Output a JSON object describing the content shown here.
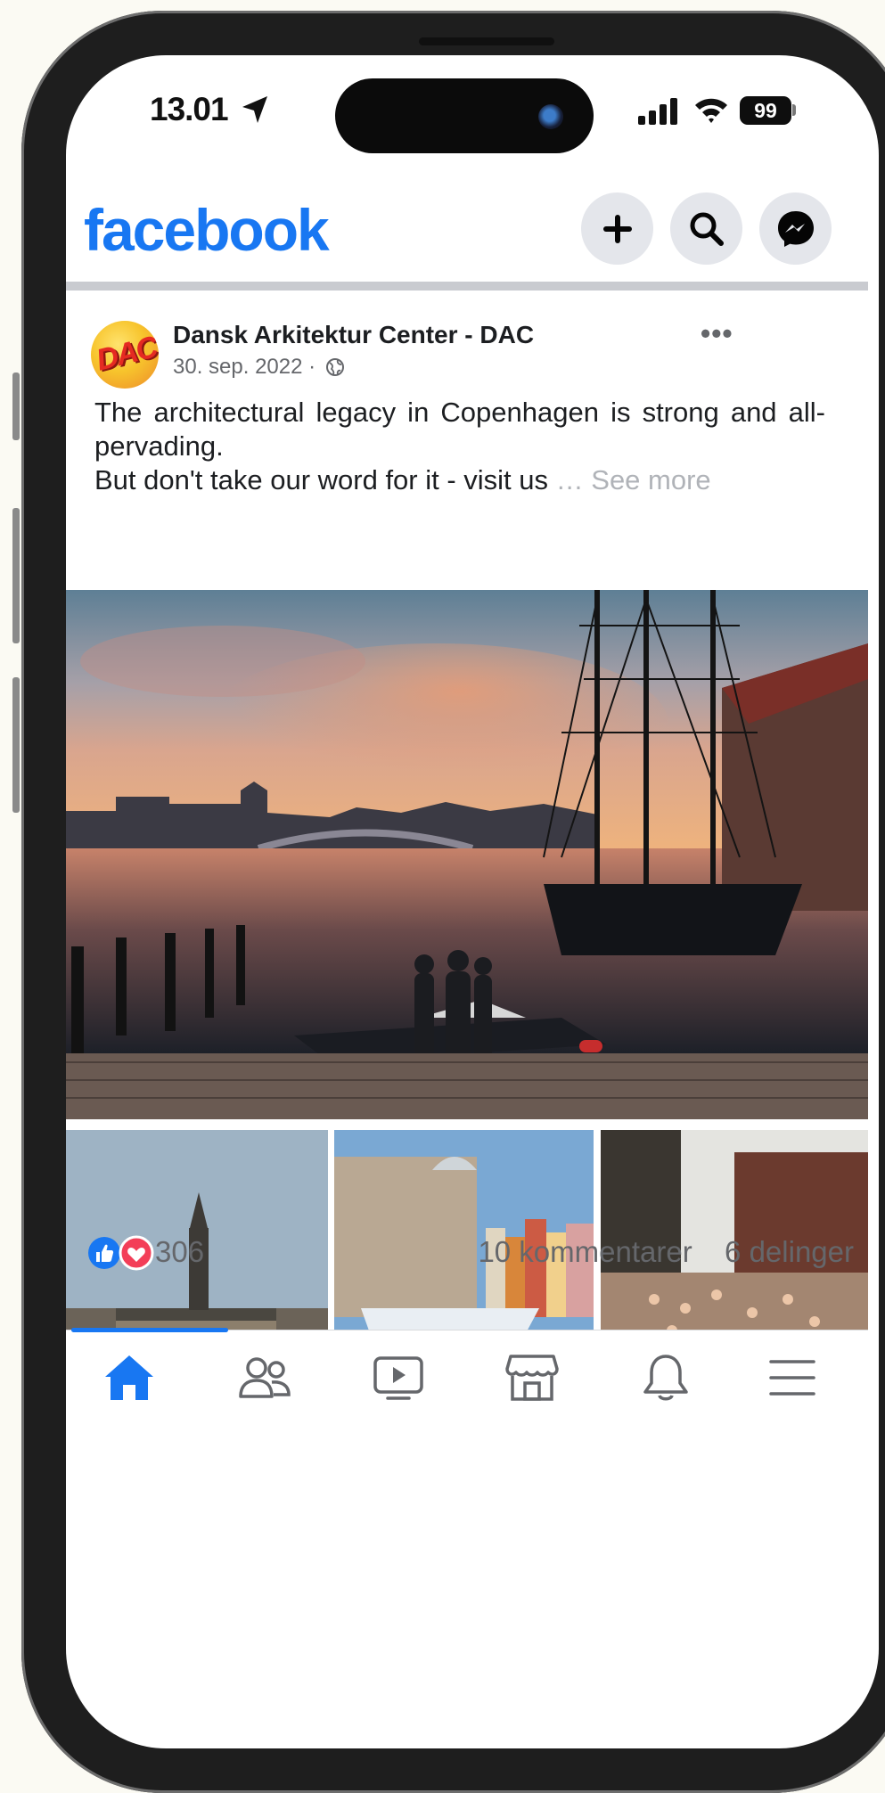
{
  "status_bar": {
    "time": "13.01",
    "battery": "99"
  },
  "header": {
    "logo_text": "facebook",
    "create_icon": "plus-icon",
    "search_icon": "search-icon",
    "messenger_icon": "messenger-icon"
  },
  "post": {
    "author": "Dansk Arkitektur Center - DAC",
    "avatar_text": "DAC",
    "date": "30. sep. 2022 ·",
    "privacy_icon": "globe-icon",
    "text_line1": "The architectural legacy in Copenhagen is strong and all-pervading.",
    "text_line2": "But don't take our word for it - visit us",
    "ellipsis": " … ",
    "see_more": "See more",
    "reactions": {
      "icons": [
        "like-icon",
        "love-icon"
      ],
      "count": "306"
    },
    "comments": "10 kommentarer",
    "shares": "6 delinger"
  },
  "bottom_nav": [
    {
      "name": "home-icon",
      "active": true
    },
    {
      "name": "friends-icon",
      "active": false
    },
    {
      "name": "watch-icon",
      "active": false
    },
    {
      "name": "marketplace-icon",
      "active": false
    },
    {
      "name": "notifications-icon",
      "active": false
    },
    {
      "name": "menu-icon",
      "active": false
    }
  ],
  "colors": {
    "brand": "#1877f2",
    "secondary_text": "#65676b",
    "see_more": "#b0b3b8",
    "love": "#f33e58"
  }
}
